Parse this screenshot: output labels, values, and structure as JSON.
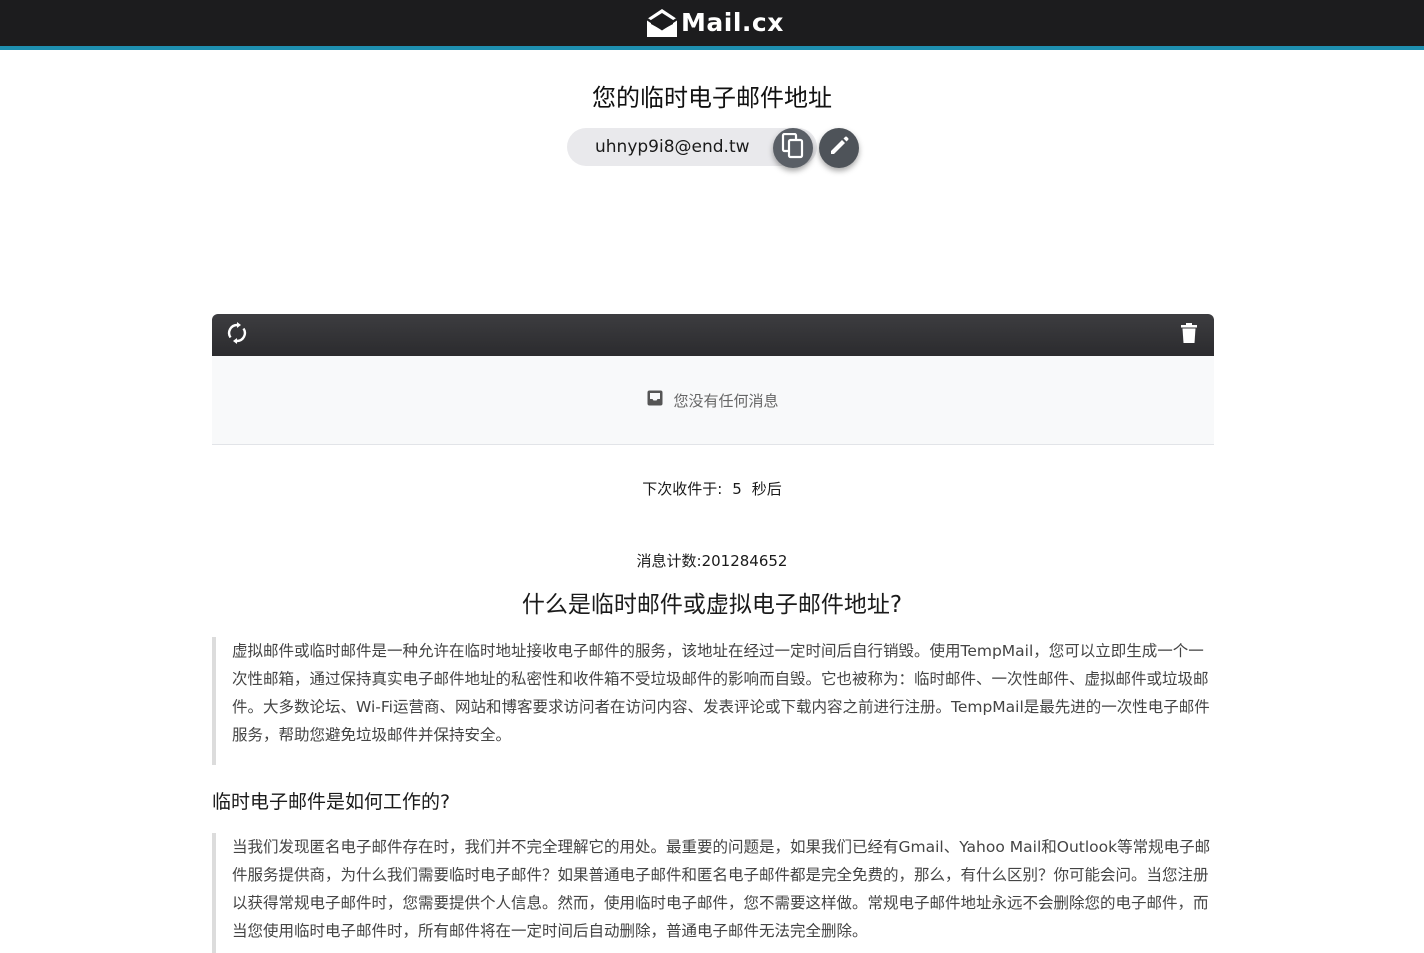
{
  "header": {
    "logo_text": "Mail.cx",
    "logo_icon": "envelope-open-icon",
    "bar_color": "#1c1c1e",
    "accent_color": "#1e8fb0"
  },
  "address": {
    "title": "您的临时电子邮件地址",
    "email": "uhnyp9i8@end.tw",
    "copy_icon": "copy-icon",
    "edit_icon": "pencil-icon"
  },
  "inbox": {
    "refresh_icon": "refresh-icon",
    "delete_icon": "trash-icon",
    "empty_icon": "inbox-icon",
    "empty_text": "您没有任何消息"
  },
  "status": {
    "next_fetch_prefix": "下次收件于:",
    "next_fetch_seconds": "5",
    "next_fetch_suffix": "秒后",
    "message_count": "消息计数:201284652"
  },
  "article": {
    "title": "什么是临时邮件或虚拟电子邮件地址?",
    "p1": "虚拟邮件或临时邮件是一种允许在临时地址接收电子邮件的服务，该地址在经过一定时间后自行销毁。使用TempMail，您可以立即生成一个一次性邮箱，通过保持真实电子邮件地址的私密性和收件箱不受垃圾邮件的影响而自毁。它也被称为：临时邮件、一次性邮件、虚拟邮件或垃圾邮件。大多数论坛、Wi-Fi运营商、网站和博客要求访问者在访问内容、发表评论或下载内容之前进行注册。TempMail是最先进的一次性电子邮件服务，帮助您避免垃圾邮件并保持安全。",
    "h2": "临时电子邮件是如何工作的?",
    "p2": "当我们发现匿名电子邮件存在时，我们并不完全理解它的用处。最重要的问题是，如果我们已经有Gmail、Yahoo Mail和Outlook等常规电子邮件服务提供商，为什么我们需要临时电子邮件？如果普通电子邮件和匿名电子邮件都是完全免费的，那么，有什么区别？你可能会问。当您注册以获得常规电子邮件时，您需要提供个人信息。然而，使用临时电子邮件，您不需要这样做。常规电子邮件地址永远不会删除您的电子邮件，而当您使用临时电子邮件时，所有邮件将在一定时间后自动删除，普通电子邮件无法完全删除。"
  }
}
